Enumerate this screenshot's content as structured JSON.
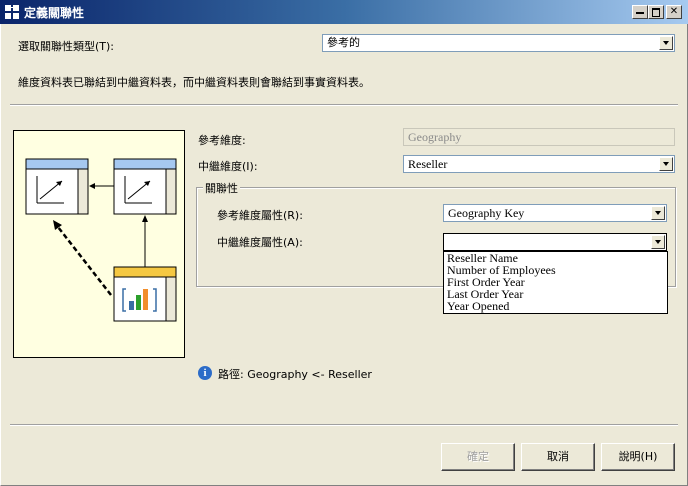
{
  "window": {
    "title": "定義關聯性"
  },
  "relationship_type": {
    "label": "選取關聯性類型(T):",
    "value": "參考的"
  },
  "description": "維度資料表已聯結到中繼資料表，而中繼資料表則會聯結到事實資料表。",
  "reference_dimension": {
    "label": "參考維度:",
    "value": "Geography"
  },
  "intermediate_dimension": {
    "label": "中繼維度(I):",
    "value": "Reseller"
  },
  "relationship_group": {
    "title": "關聯性",
    "reference_attribute_label": "參考維度屬性(R):",
    "reference_attribute_value": "Geography Key",
    "intermediate_attribute_label": "中繼維度屬性(A):",
    "intermediate_attribute_value": "",
    "options": [
      "Reseller Name",
      "Number of Employees",
      "First Order Year",
      "Last Order Year",
      "Year Opened"
    ]
  },
  "path": {
    "text": "路徑: Geography <- Reseller"
  },
  "buttons": {
    "ok": "確定",
    "cancel": "取消",
    "help": "說明(H)"
  },
  "colors": {
    "diagram_background": "#ffffe1",
    "dimension_table_header": "#a6c8f0",
    "fact_table_header": "#f5c842",
    "titlebar": "#0a246a"
  }
}
